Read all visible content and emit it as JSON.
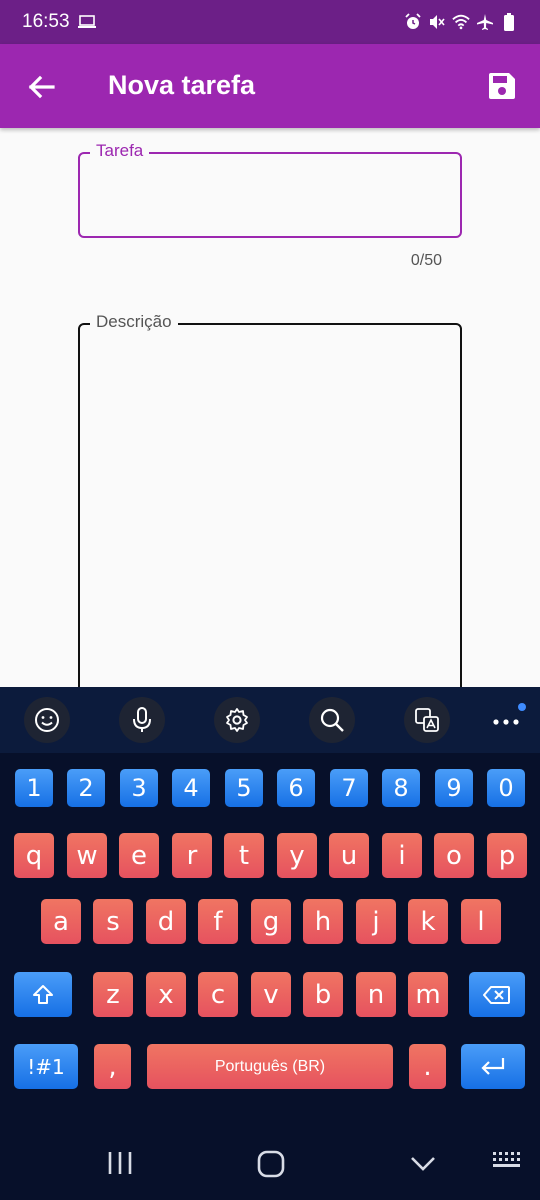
{
  "status": {
    "time": "16:53"
  },
  "appbar": {
    "title": "Nova tarefa",
    "back_icon": "arrow-left-icon",
    "save_icon": "save-icon"
  },
  "form": {
    "tarefa": {
      "label": "Tarefa",
      "value": "",
      "counter": "0/50"
    },
    "descricao": {
      "label": "Descrição",
      "value": ""
    }
  },
  "keyboard": {
    "toolbar": [
      "emoji-icon",
      "microphone-icon",
      "settings-icon",
      "search-icon",
      "translate-icon",
      "more-icon"
    ],
    "numbers": [
      "1",
      "2",
      "3",
      "4",
      "5",
      "6",
      "7",
      "8",
      "9",
      "0"
    ],
    "row1": [
      "q",
      "w",
      "e",
      "r",
      "t",
      "y",
      "u",
      "i",
      "o",
      "p"
    ],
    "row2": [
      "a",
      "s",
      "d",
      "f",
      "g",
      "h",
      "j",
      "k",
      "l"
    ],
    "row3": [
      "z",
      "x",
      "c",
      "v",
      "b",
      "n",
      "m"
    ],
    "symbols_label": "!#1",
    "comma": ",",
    "space_label": "Português (BR)",
    "period": "."
  },
  "colors": {
    "status_bar": "#6c1f87",
    "app_bar": "#9c27b0",
    "keyboard_bg": "#07102a"
  }
}
